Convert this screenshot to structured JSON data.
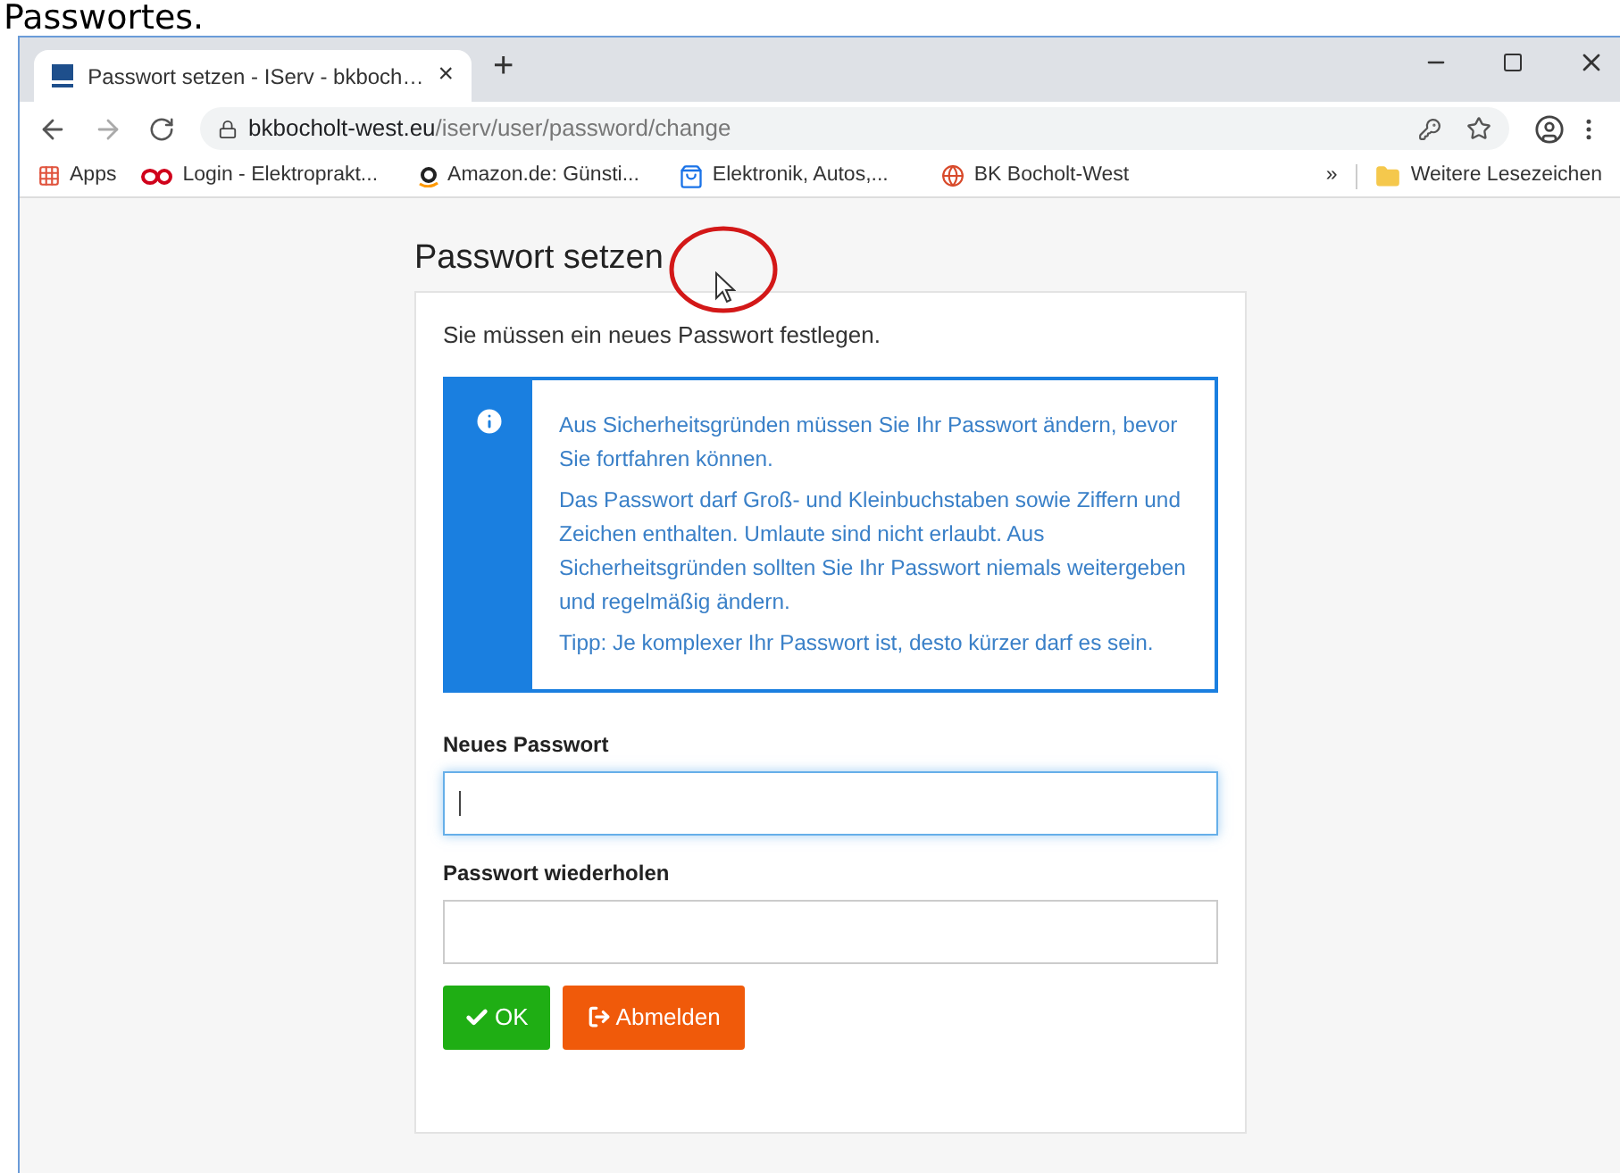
{
  "document_text": "Passwortes.",
  "browser": {
    "tab": {
      "title": "Passwort setzen - IServ - bkboch…",
      "close": "×"
    },
    "new_tab": "+",
    "url": {
      "host": "bkbocholt-west.eu",
      "path": "/iserv/user/password/change"
    },
    "bookmarks": [
      {
        "kind": "apps",
        "label": "Apps"
      },
      {
        "kind": "ep",
        "label": "Login - Elektroprakt..."
      },
      {
        "kind": "amazon",
        "label": "Amazon.de: Günsti..."
      },
      {
        "kind": "bag",
        "label": "Elektronik, Autos,..."
      },
      {
        "kind": "globe",
        "label": "BK Bocholt-West"
      }
    ],
    "more": "»",
    "other_bookmarks": "Weitere Lesezeichen"
  },
  "page": {
    "title": "Passwort setzen",
    "intro": "Sie müssen ein neues Passwort festlegen.",
    "info": [
      "Aus Sicherheitsgründen müssen Sie Ihr Passwort ändern, bevor Sie fortfahren können.",
      "Das Passwort darf Groß- und Kleinbuchstaben sowie Ziffern und Zeichen enthalten. Umlaute sind nicht erlaubt. Aus Sicherheitsgründen sollten Sie Ihr Passwort niemals weitergeben und regelmäßig ändern.",
      "Tipp: Je komplexer Ihr Passwort ist, desto kürzer darf es sein."
    ],
    "fields": [
      {
        "label": "Neues Passwort",
        "focused": true
      },
      {
        "label": "Passwort wiederholen",
        "focused": false
      }
    ],
    "buttons": [
      {
        "kind": "ok",
        "label": "OK"
      },
      {
        "kind": "logout",
        "label": "Abmelden"
      }
    ]
  }
}
